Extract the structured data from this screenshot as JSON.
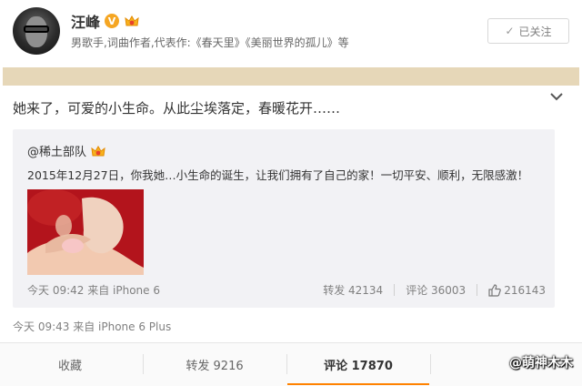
{
  "profile": {
    "name": "汪峰",
    "description": "男歌手,词曲作者,代表作:《春天里》《美丽世界的孤儿》等",
    "follow_label": "已关注"
  },
  "post": {
    "text": "她来了，可爱的小生命。从此尘埃落定，春暖花开……",
    "meta": "今天 09:43 来自 iPhone 6 Plus"
  },
  "repost": {
    "user": "@稀土部队",
    "text": "2015年12月27日，你我她…小生命的诞生，让我们拥有了自己的家！一切平安、顺利，无限感激！",
    "meta": "今天 09:42 来自 iPhone 6",
    "forward": "转发 42134",
    "comment": "评论 36003",
    "likes": "216143"
  },
  "actions": {
    "favorite": "收藏",
    "forward": "转发 9216",
    "comment": "评论 17870"
  },
  "watermark": "@萌神木木",
  "colors": {
    "accent": "#ff8200",
    "band": "#e6d7b8",
    "verified": "#f5a623"
  }
}
